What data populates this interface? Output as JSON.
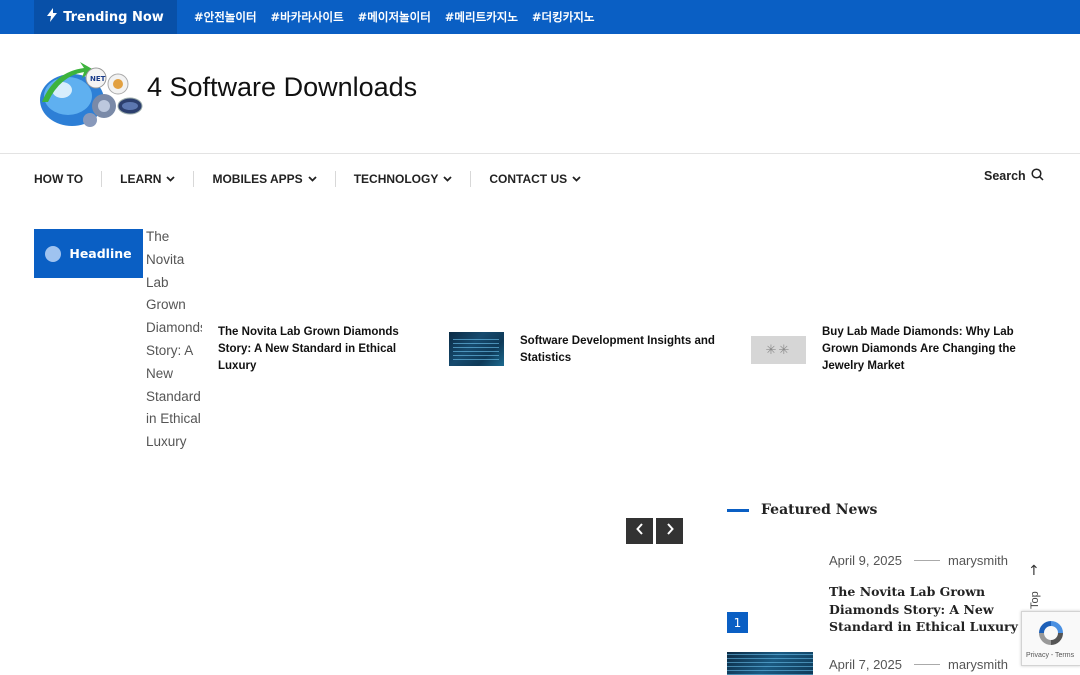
{
  "topbar": {
    "trending_label": "Trending Now",
    "tags": [
      "#안전놀이터",
      "#바카라사이트",
      "#메이저놀이터",
      "#메리트카지노",
      "#더킹카지노"
    ]
  },
  "header": {
    "site_title": "4 Software Downloads",
    "logo_text": "NET"
  },
  "nav": {
    "items": [
      {
        "label": "HOW TO",
        "dropdown": false
      },
      {
        "label": "LEARN",
        "dropdown": true
      },
      {
        "label": "MOBILES APPS",
        "dropdown": true
      },
      {
        "label": "TECHNOLOGY",
        "dropdown": true
      },
      {
        "label": "CONTACT US",
        "dropdown": true
      }
    ],
    "search_label": "Search"
  },
  "headline": {
    "badge_label": "Headline",
    "broken_image_alt": "The Novita Lab Grown Diamonds Story: A New Standard in Ethical Luxury",
    "items": [
      {
        "title": "The Novita Lab Grown Diamonds Story: A New Standard in Ethical Luxury"
      },
      {
        "title": "Software Development Insights and Statistics"
      },
      {
        "title": "Buy Lab Made Diamonds: Why Lab Grown Diamonds Are Changing the Jewelry Market"
      }
    ],
    "prev_icon": "‹",
    "next_icon": "›"
  },
  "featured": {
    "section_title": "Featured News",
    "posts": [
      {
        "date": "April 9, 2025",
        "author": "marysmith",
        "title": "The Novita Lab Grown Diamonds Story: A New Standard in Ethical Luxury",
        "number": "1"
      },
      {
        "date": "April 7, 2025",
        "author": "marysmith"
      }
    ]
  },
  "back_to_top": {
    "label": "Back To Top",
    "icon": "↑"
  },
  "recaptcha": {
    "links": "Privacy - Terms"
  },
  "colors": {
    "accent": "#0a5fc4",
    "accent_dark": "#0850a8",
    "arrow_bg": "#333333"
  }
}
